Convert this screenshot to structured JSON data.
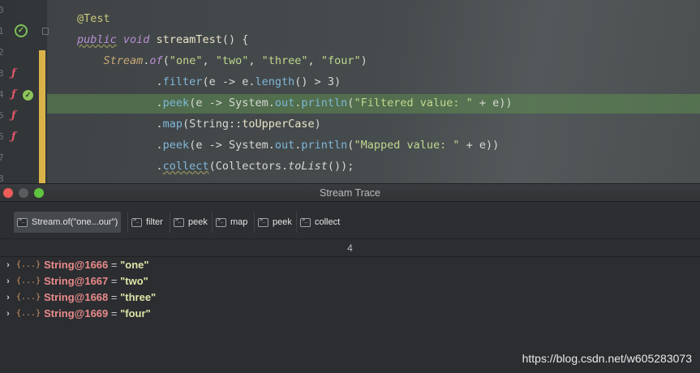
{
  "editor": {
    "line_numbers": [
      "0",
      "1",
      "2",
      "3",
      "4",
      "5",
      "6",
      "7",
      "8"
    ],
    "lines": [
      [
        {
          "t": "@Test",
          "c": "ann"
        }
      ],
      [
        {
          "t": "public",
          "c": "kwu"
        },
        {
          "t": " ",
          "c": "punc"
        },
        {
          "t": "void",
          "c": "kw"
        },
        {
          "t": " streamTest",
          "c": "id"
        },
        {
          "t": "() {",
          "c": "punc"
        }
      ],
      [
        {
          "t": "    Stream",
          "c": "type"
        },
        {
          "t": ".",
          "c": "punc"
        },
        {
          "t": "of",
          "c": "kw"
        },
        {
          "t": "(",
          "c": "punc"
        },
        {
          "t": "\"one\"",
          "c": "str"
        },
        {
          "t": ", ",
          "c": "punc"
        },
        {
          "t": "\"two\"",
          "c": "str"
        },
        {
          "t": ", ",
          "c": "punc"
        },
        {
          "t": "\"three\"",
          "c": "str"
        },
        {
          "t": ", ",
          "c": "punc"
        },
        {
          "t": "\"four\"",
          "c": "str"
        },
        {
          "t": ")",
          "c": "punc"
        }
      ],
      [
        {
          "t": "            .",
          "c": "punc"
        },
        {
          "t": "filter",
          "c": "fn"
        },
        {
          "t": "(e -> e.",
          "c": "punc"
        },
        {
          "t": "length",
          "c": "fn"
        },
        {
          "t": "() > 3)",
          "c": "punc"
        }
      ],
      [
        {
          "t": "            .",
          "c": "punc"
        },
        {
          "t": "peek",
          "c": "fn"
        },
        {
          "t": "(e -> System.",
          "c": "punc"
        },
        {
          "t": "out",
          "c": "fn"
        },
        {
          "t": ".",
          "c": "punc"
        },
        {
          "t": "println",
          "c": "fn"
        },
        {
          "t": "(",
          "c": "punc"
        },
        {
          "t": "\"Filtered value: \"",
          "c": "str"
        },
        {
          "t": " + e))",
          "c": "punc"
        }
      ],
      [
        {
          "t": "            .",
          "c": "punc"
        },
        {
          "t": "map",
          "c": "fn"
        },
        {
          "t": "(String::",
          "c": "punc"
        },
        {
          "t": "toUpperCase",
          "c": "id"
        },
        {
          "t": ")",
          "c": "punc"
        }
      ],
      [
        {
          "t": "            .",
          "c": "punc"
        },
        {
          "t": "peek",
          "c": "fn"
        },
        {
          "t": "(e -> System.",
          "c": "punc"
        },
        {
          "t": "out",
          "c": "fn"
        },
        {
          "t": ".",
          "c": "punc"
        },
        {
          "t": "println",
          "c": "fn"
        },
        {
          "t": "(",
          "c": "punc"
        },
        {
          "t": "\"Mapped value: \"",
          "c": "str"
        },
        {
          "t": " + e))",
          "c": "punc"
        }
      ],
      [
        {
          "t": "            .",
          "c": "punc"
        },
        {
          "t": "collect",
          "c": "fnu"
        },
        {
          "t": "(Collectors.",
          "c": "punc"
        },
        {
          "t": "toList",
          "c": "italic"
        },
        {
          "t": "());",
          "c": "punc"
        }
      ]
    ]
  },
  "trace": {
    "window_title": "Stream Trace",
    "tabs": [
      {
        "label": "Stream.of(\"one...our\")",
        "active": true
      },
      {
        "label": "filter",
        "active": false
      },
      {
        "label": "peek",
        "active": false
      },
      {
        "label": "map",
        "active": false
      },
      {
        "label": "peek",
        "active": false
      },
      {
        "label": "collect",
        "active": false
      }
    ],
    "count": "4",
    "items": [
      {
        "expand": "›",
        "icon": "{...}",
        "name": "String@1666",
        "eq": " = ",
        "value": "\"one\""
      },
      {
        "expand": "›",
        "icon": "{...}",
        "name": "String@1667",
        "eq": " = ",
        "value": "\"two\""
      },
      {
        "expand": "›",
        "icon": "{...}",
        "name": "String@1668",
        "eq": " = ",
        "value": "\"three\""
      },
      {
        "expand": "›",
        "icon": "{...}",
        "name": "String@1669",
        "eq": " = ",
        "value": "\"four\""
      }
    ]
  },
  "watermark": "https://blog.csdn.net/w605283073"
}
